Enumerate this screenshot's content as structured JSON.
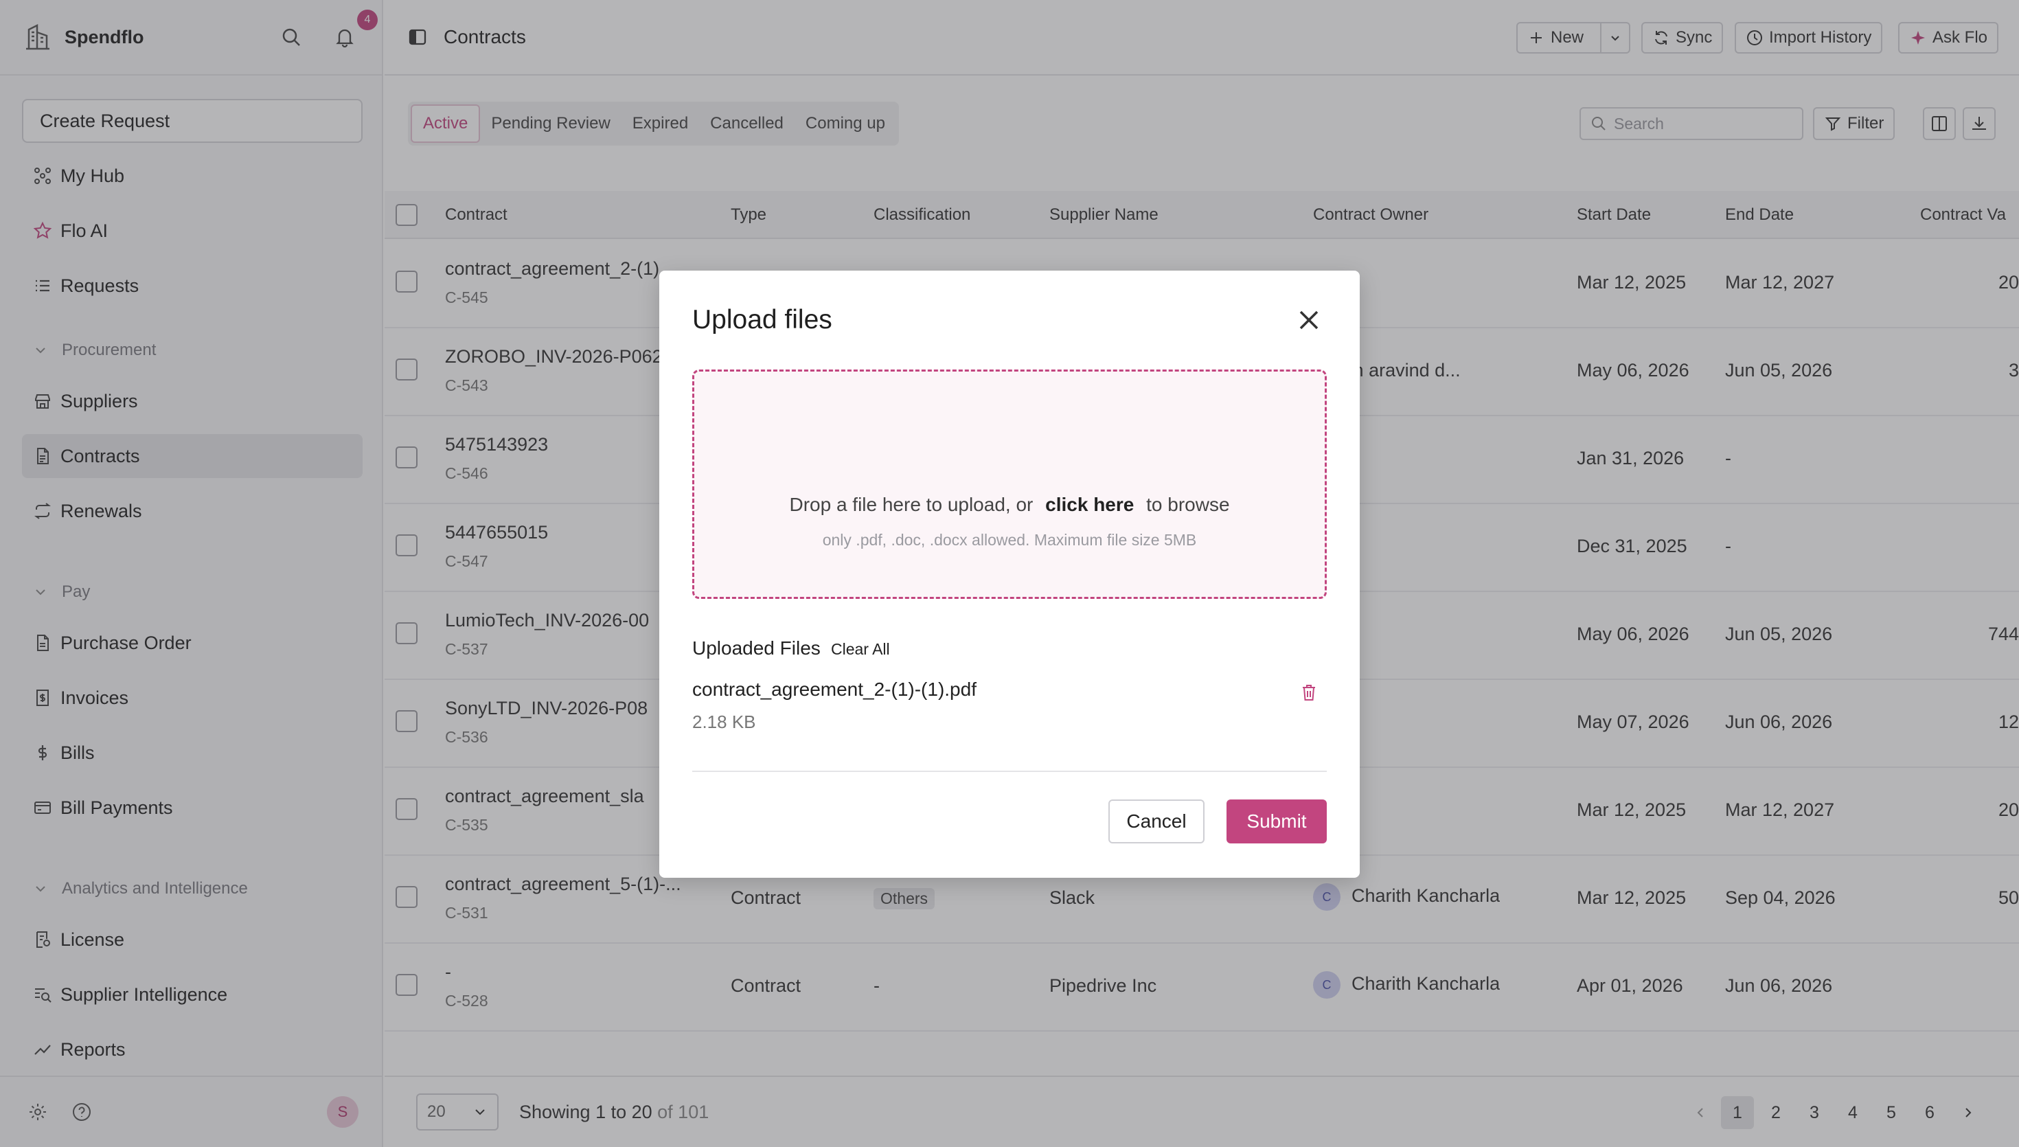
{
  "sidebar": {
    "brand": "Spendflo",
    "notification_count": "4",
    "create_request": "Create Request",
    "items": {
      "my_hub": "My Hub",
      "flo_ai": "Flo AI",
      "requests": "Requests",
      "suppliers": "Suppliers",
      "contracts": "Contracts",
      "renewals": "Renewals",
      "purchase_order": "Purchase Order",
      "invoices": "Invoices",
      "bills": "Bills",
      "bill_payments": "Bill Payments",
      "license": "License",
      "supplier_intelligence": "Supplier Intelligence",
      "reports": "Reports"
    },
    "sections": {
      "procurement": "Procurement",
      "pay": "Pay",
      "analytics": "Analytics and Intelligence"
    },
    "user_initial": "S"
  },
  "header": {
    "title": "Contracts",
    "new_label": "New",
    "sync_label": "Sync",
    "import_history_label": "Import History",
    "ask_flo_label": "Ask Flo"
  },
  "tabs": [
    "Active",
    "Pending Review",
    "Expired",
    "Cancelled",
    "Coming up"
  ],
  "toolbar": {
    "search_placeholder": "Search",
    "filter_label": "Filter"
  },
  "table": {
    "columns": [
      "Contract",
      "Type",
      "Classification",
      "Supplier Name",
      "Contract Owner",
      "Start Date",
      "End Date",
      "Contract Va"
    ],
    "rows": [
      {
        "name": "contract_agreement_2-(1)",
        "id": "C-545",
        "type": "",
        "classification": "",
        "supplier": "",
        "owner": "",
        "owner_initial": "",
        "start": "Mar 12, 2025",
        "end": "Mar 12, 2027",
        "value": "20"
      },
      {
        "name": "ZOROBO_INV-2026-P062",
        "id": "C-543",
        "type": "",
        "classification": "",
        "supplier": "",
        "owner": "anesh aravind d...",
        "owner_initial": "",
        "start": "May 06, 2026",
        "end": "Jun 05, 2026",
        "value": "3"
      },
      {
        "name": "5475143923",
        "id": "C-546",
        "type": "",
        "classification": "",
        "supplier": "",
        "owner": "",
        "owner_initial": "",
        "start": "Jan 31, 2026",
        "end": "-",
        "value": ""
      },
      {
        "name": "5447655015",
        "id": "C-547",
        "type": "",
        "classification": "",
        "supplier": "",
        "owner": "",
        "owner_initial": "",
        "start": "Dec 31, 2025",
        "end": "-",
        "value": ""
      },
      {
        "name": "LumioTech_INV-2026-00",
        "id": "C-537",
        "type": "",
        "classification": "",
        "supplier": "",
        "owner": "",
        "owner_initial": "",
        "start": "May 06, 2026",
        "end": "Jun 05, 2026",
        "value": "744"
      },
      {
        "name": "SonyLTD_INV-2026-P08",
        "id": "C-536",
        "type": "",
        "classification": "",
        "supplier": "",
        "owner": "",
        "owner_initial": "",
        "start": "May 07, 2026",
        "end": "Jun 06, 2026",
        "value": "12"
      },
      {
        "name": "contract_agreement_sla",
        "id": "C-535",
        "type": "",
        "classification": "",
        "supplier": "",
        "owner": "",
        "owner_initial": "",
        "start": "Mar 12, 2025",
        "end": "Mar 12, 2027",
        "value": "20"
      },
      {
        "name": "contract_agreement_5-(1)-...",
        "id": "C-531",
        "type": "Contract",
        "classification": "Others",
        "supplier": "Slack",
        "owner": "Charith Kancharla",
        "owner_initial": "C",
        "start": "Mar 12, 2025",
        "end": "Sep 04, 2026",
        "value": "50"
      },
      {
        "name": "-",
        "id": "C-528",
        "type": "Contract",
        "classification": "-",
        "supplier": "Pipedrive Inc",
        "owner": "Charith Kancharla",
        "owner_initial": "C",
        "start": "Apr 01, 2026",
        "end": "Jun 06, 2026",
        "value": ""
      }
    ]
  },
  "footer": {
    "per_page": "20",
    "showing": "Showing 1 to 20",
    "of_total": "of 101",
    "pages": [
      "1",
      "2",
      "3",
      "4",
      "5",
      "6"
    ]
  },
  "modal": {
    "title": "Upload files",
    "drop_text": "Drop a file here to upload, or",
    "click_here": "click here",
    "to_browse": "to browse",
    "hint": "only .pdf, .doc, .docx allowed. Maximum file size 5MB",
    "uploaded_label": "Uploaded Files",
    "clear_all": "Clear All",
    "file_name": "contract_agreement_2-(1)-(1).pdf",
    "file_size": "2.18 KB",
    "cancel": "Cancel",
    "submit": "Submit"
  },
  "colors": {
    "accent": "#c2457f",
    "overlay": "#3c3c42"
  },
  "icons": {
    "logo": "building-icon",
    "search": "search-icon",
    "bell": "bell-icon",
    "close": "close-icon",
    "trash": "trash-icon"
  }
}
